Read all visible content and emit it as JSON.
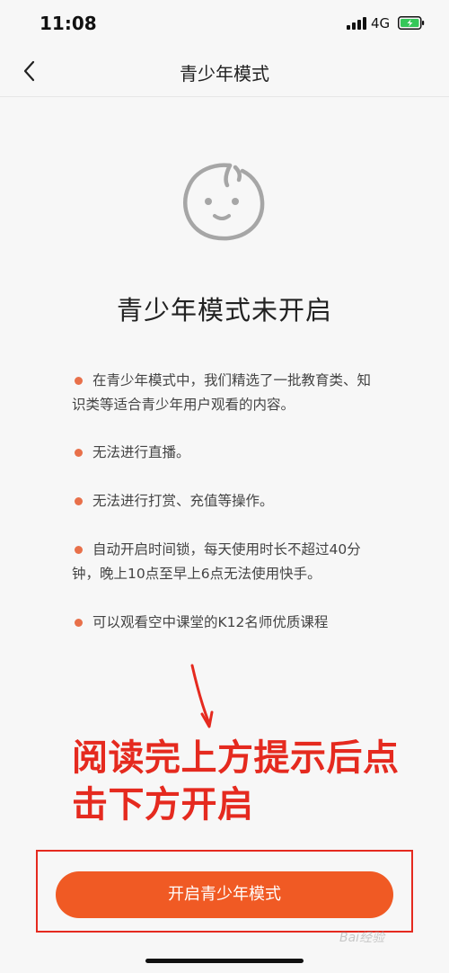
{
  "status_bar": {
    "time": "11:08",
    "network": "4G",
    "battery_color": "#35c759"
  },
  "nav": {
    "back_icon": "chevron-left-icon",
    "title": "青少年模式"
  },
  "hero": {
    "icon": "baby-face-icon",
    "title": "青少年模式未开启"
  },
  "bullets": [
    "在青少年模式中，我们精选了一批教育类、知识类等适合青少年用户观看的内容。",
    "无法进行直播。",
    "无法进行打赏、充值等操作。",
    "自动开启时间锁，每天使用时长不超过40分钟，晚上10点至早上6点无法使用快手。",
    "可以观看空中课堂的K12名师优质课程"
  ],
  "annotation": {
    "text": "阅读完上方提示后点击下方开启",
    "color": "#e52a1f"
  },
  "button": {
    "label": "开启青少年模式",
    "color": "#f05a24"
  },
  "accent_dot_color": "#e8704a",
  "watermark": "Bai经验"
}
